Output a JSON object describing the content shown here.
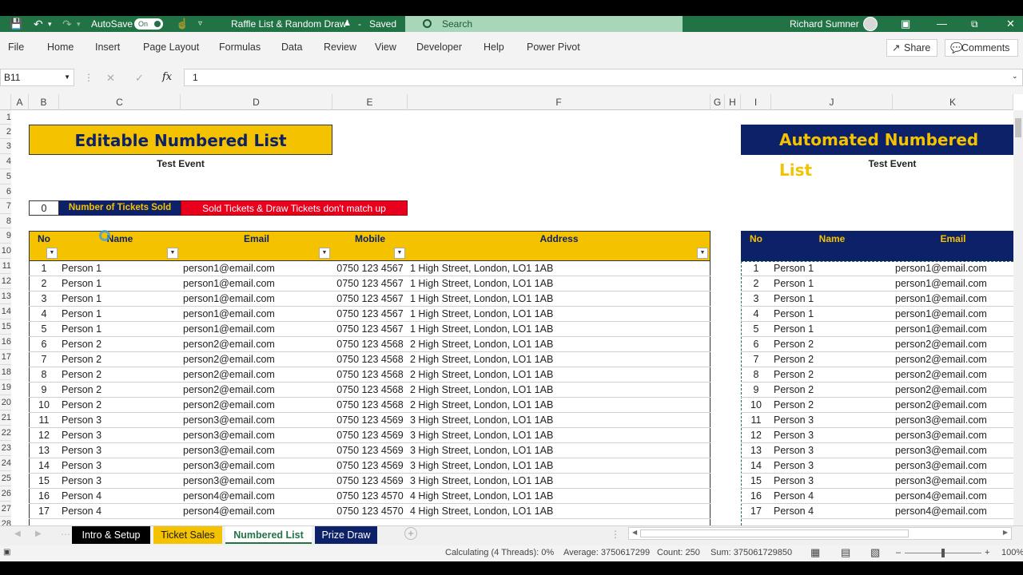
{
  "titlebar": {
    "autosave_label": "AutoSave",
    "autosave_state": "On",
    "doc_title": "Raffle List & Random Draw",
    "save_state": "Saved",
    "search_placeholder": "Search",
    "user_name": "Richard Sumner"
  },
  "menu": {
    "items": [
      "File",
      "Home",
      "Insert",
      "Page Layout",
      "Formulas",
      "Data",
      "Review",
      "View",
      "Developer",
      "Help",
      "Power Pivot"
    ],
    "share_label": "Share",
    "comments_label": "Comments"
  },
  "formula_bar": {
    "name_box": "B11",
    "fx_label": "fx",
    "value": "1"
  },
  "columns": [
    "A",
    "B",
    "C",
    "D",
    "E",
    "F",
    "G",
    "H",
    "I",
    "J",
    "K"
  ],
  "rows_visible": [
    "1",
    "2",
    "3",
    "4",
    "5",
    "6",
    "7",
    "8",
    "9",
    "10",
    "11",
    "12",
    "13",
    "14",
    "15",
    "16",
    "17",
    "18",
    "19",
    "20",
    "21",
    "22",
    "23",
    "24",
    "25",
    "26",
    "27",
    "28"
  ],
  "left_panel": {
    "title": "Editable Numbered List",
    "event": "Test Event",
    "tickets_sold": "0",
    "tickets_sold_label": "Number of Tickets Sold",
    "warning": "Sold Tickets & Draw Tickets don't match up",
    "headers": [
      "No",
      "Name",
      "Email",
      "Mobile",
      "Address"
    ]
  },
  "right_panel": {
    "title": "Automated Numbered List",
    "event": "Test Event",
    "headers": [
      "No",
      "Name",
      "Email"
    ]
  },
  "table_rows": [
    {
      "no": "1",
      "name": "Person 1",
      "email": "person1@email.com",
      "mobile": "0750 123 4567",
      "address": "1 High Street, London, LO1 1AB"
    },
    {
      "no": "2",
      "name": "Person 1",
      "email": "person1@email.com",
      "mobile": "0750 123 4567",
      "address": "1 High Street, London, LO1 1AB"
    },
    {
      "no": "3",
      "name": "Person 1",
      "email": "person1@email.com",
      "mobile": "0750 123 4567",
      "address": "1 High Street, London, LO1 1AB"
    },
    {
      "no": "4",
      "name": "Person 1",
      "email": "person1@email.com",
      "mobile": "0750 123 4567",
      "address": "1 High Street, London, LO1 1AB"
    },
    {
      "no": "5",
      "name": "Person 1",
      "email": "person1@email.com",
      "mobile": "0750 123 4567",
      "address": "1 High Street, London, LO1 1AB"
    },
    {
      "no": "6",
      "name": "Person 2",
      "email": "person2@email.com",
      "mobile": "0750 123 4568",
      "address": "2 High Street, London, LO1 1AB"
    },
    {
      "no": "7",
      "name": "Person 2",
      "email": "person2@email.com",
      "mobile": "0750 123 4568",
      "address": "2 High Street, London, LO1 1AB"
    },
    {
      "no": "8",
      "name": "Person 2",
      "email": "person2@email.com",
      "mobile": "0750 123 4568",
      "address": "2 High Street, London, LO1 1AB"
    },
    {
      "no": "9",
      "name": "Person 2",
      "email": "person2@email.com",
      "mobile": "0750 123 4568",
      "address": "2 High Street, London, LO1 1AB"
    },
    {
      "no": "10",
      "name": "Person 2",
      "email": "person2@email.com",
      "mobile": "0750 123 4568",
      "address": "2 High Street, London, LO1 1AB"
    },
    {
      "no": "11",
      "name": "Person 3",
      "email": "person3@email.com",
      "mobile": "0750 123 4569",
      "address": "3 High Street, London, LO1 1AB"
    },
    {
      "no": "12",
      "name": "Person 3",
      "email": "person3@email.com",
      "mobile": "0750 123 4569",
      "address": "3 High Street, London, LO1 1AB"
    },
    {
      "no": "13",
      "name": "Person 3",
      "email": "person3@email.com",
      "mobile": "0750 123 4569",
      "address": "3 High Street, London, LO1 1AB"
    },
    {
      "no": "14",
      "name": "Person 3",
      "email": "person3@email.com",
      "mobile": "0750 123 4569",
      "address": "3 High Street, London, LO1 1AB"
    },
    {
      "no": "15",
      "name": "Person 3",
      "email": "person3@email.com",
      "mobile": "0750 123 4569",
      "address": "3 High Street, London, LO1 1AB"
    },
    {
      "no": "16",
      "name": "Person 4",
      "email": "person4@email.com",
      "mobile": "0750 123 4570",
      "address": "4 High Street, London, LO1 1AB"
    },
    {
      "no": "17",
      "name": "Person 4",
      "email": "person4@email.com",
      "mobile": "0750 123 4570",
      "address": "4 High Street, London, LO1 1AB"
    }
  ],
  "sheet_tabs": [
    {
      "label": "Intro & Setup",
      "bg": "#000000",
      "fg": "#ffffff"
    },
    {
      "label": "Ticket Sales",
      "bg": "#f5c200",
      "fg": "#1a1a1a"
    },
    {
      "label": "Numbered List",
      "bg": "#ffffff",
      "fg": "#217346"
    },
    {
      "label": "Prize Draw",
      "bg": "#0d2169",
      "fg": "#ffffff"
    }
  ],
  "status": {
    "calculating": "Calculating (4 Threads): 0%",
    "average": "Average: 3750617299",
    "count": "Count: 250",
    "sum": "Sum: 375061729850",
    "zoom": "100%"
  },
  "colors": {
    "excel_green": "#217346",
    "gold": "#f5c200",
    "navy": "#0d2169",
    "red": "#e8001c"
  }
}
